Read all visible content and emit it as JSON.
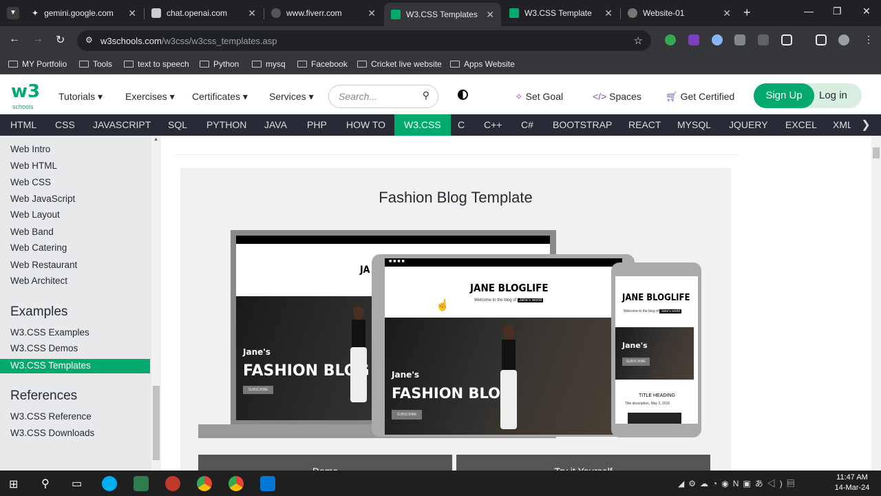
{
  "browser": {
    "tabs": [
      {
        "title": "gemini.google.com"
      },
      {
        "title": "chat.openai.com"
      },
      {
        "title": "www.fiverr.com"
      },
      {
        "title": "W3.CSS Templates"
      },
      {
        "title": "W3.CSS Template"
      },
      {
        "title": "Website-01"
      }
    ],
    "url_host": "w3schools.com",
    "url_path": "/w3css/w3css_templates.asp",
    "bookmarks": [
      "MY Portfolio",
      "Tools",
      "text to speech",
      "Python",
      "mysq",
      "Facebook",
      "Cricket live website",
      "Apps Website"
    ]
  },
  "header": {
    "logo_big": "w3",
    "logo_small": "schools",
    "menu": [
      "Tutorials",
      "Exercises",
      "Certificates",
      "Services"
    ],
    "search_placeholder": "Search...",
    "set_goal": "Set Goal",
    "spaces": "Spaces",
    "get_certified": "Get Certified",
    "sign_up": "Sign Up",
    "log_in": "Log in"
  },
  "topnav": [
    "HTML",
    "CSS",
    "JAVASCRIPT",
    "SQL",
    "PYTHON",
    "JAVA",
    "PHP",
    "HOW TO",
    "W3.CSS",
    "C",
    "C++",
    "C#",
    "BOOTSTRAP",
    "REACT",
    "MYSQL",
    "JQUERY",
    "EXCEL",
    "XML"
  ],
  "sidebar": {
    "web_items": [
      "Web Intro",
      "Web HTML",
      "Web CSS",
      "Web JavaScript",
      "Web Layout",
      "Web Band",
      "Web Catering",
      "Web Restaurant",
      "Web Architect"
    ],
    "examples_heading": "Examples",
    "examples_items": [
      "W3.CSS Examples",
      "W3.CSS Demos",
      "W3.CSS Templates"
    ],
    "references_heading": "References",
    "references_items": [
      "W3.CSS Reference",
      "W3.CSS Downloads"
    ]
  },
  "main": {
    "title": "Fashion Blog Template",
    "blog_name": "JANE BLOGLIFE",
    "welcome": "Welcome to the blog of",
    "welcome_badge": "Jane's world",
    "hero_small": "Jane's",
    "hero_big": "FASHION BLOG",
    "subscribe": "SUBSCRIBE",
    "phone_heading": "TITLE HEADING",
    "phone_desc": "Title description, May 2, 2016",
    "btn_demo": "Demo",
    "btn_try": "Try it Yourself"
  },
  "taskbar": {
    "time": "11:47 AM",
    "date": "14-Mar-24"
  },
  "colors": {
    "accent": "#04aa6d",
    "nav_dark": "#282a35",
    "sidebar_bg": "#e7e9eb"
  }
}
